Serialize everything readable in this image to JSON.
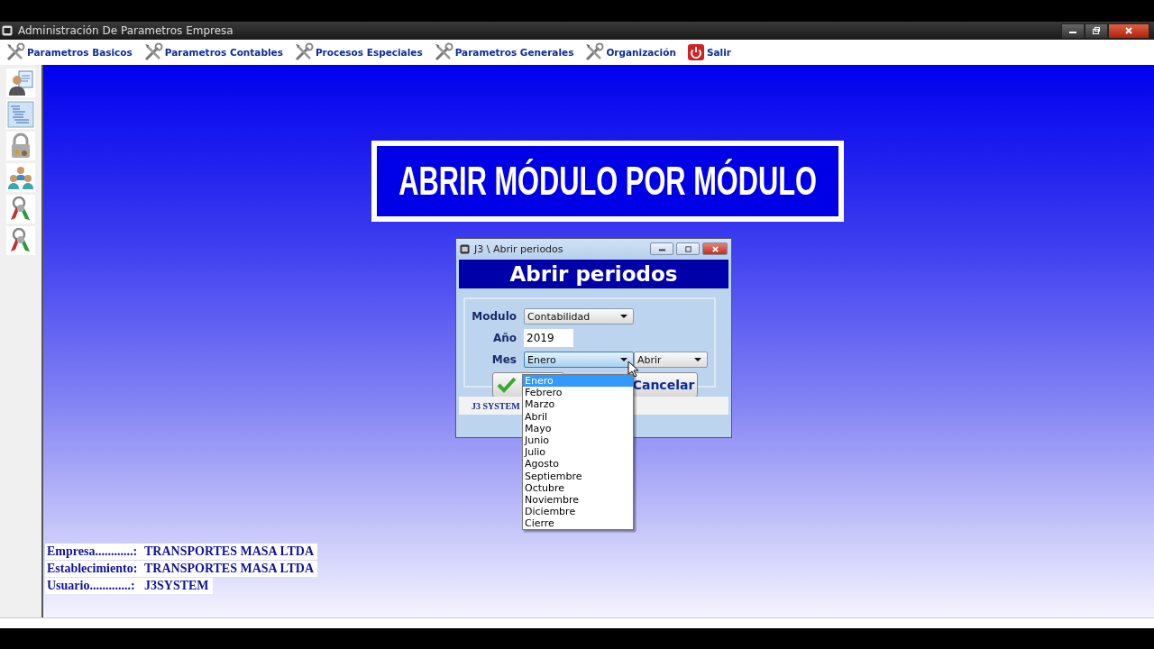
{
  "window": {
    "title": "Administración De Parametros Empresa"
  },
  "menu": [
    {
      "label": "Parametros Basicos",
      "kind": "tools"
    },
    {
      "label": "Parametros Contables",
      "kind": "tools"
    },
    {
      "label": "Procesos Especiales",
      "kind": "tools"
    },
    {
      "label": "Parametros Generales",
      "kind": "tools"
    },
    {
      "label": "Organización",
      "kind": "tools"
    },
    {
      "label": "Salir",
      "kind": "power"
    }
  ],
  "sidebar": [
    {
      "kind": "person-card"
    },
    {
      "kind": "document"
    },
    {
      "kind": "padlock"
    },
    {
      "kind": "people"
    },
    {
      "kind": "keys"
    },
    {
      "kind": "keys"
    }
  ],
  "banner": {
    "text": "ABRIR MÓDULO POR MÓDULO"
  },
  "dialog": {
    "title": "J3 \\ Abrir periodos",
    "heading": "Abrir periodos",
    "modulo": {
      "label": "Modulo",
      "value": "Contabilidad"
    },
    "ano": {
      "label": "Año",
      "value": "2019"
    },
    "mes": {
      "label": "Mes",
      "value": "Enero",
      "action": "Abrir"
    },
    "options": [
      {
        "label": "Enero",
        "selected": true
      },
      {
        "label": "Febrero",
        "selected": false
      },
      {
        "label": "Marzo",
        "selected": false
      },
      {
        "label": "Abril",
        "selected": false
      },
      {
        "label": "Mayo",
        "selected": false
      },
      {
        "label": "Junio",
        "selected": false
      },
      {
        "label": "Julio",
        "selected": false
      },
      {
        "label": "Agosto",
        "selected": false
      },
      {
        "label": "Septiembre",
        "selected": false
      },
      {
        "label": "Octubre",
        "selected": false
      },
      {
        "label": "Noviembre",
        "selected": false
      },
      {
        "label": "Diciembre",
        "selected": false
      },
      {
        "label": "Cierre",
        "selected": false
      }
    ],
    "cancel": "Cancelar",
    "status": "J3 SYSTEM"
  },
  "info": [
    {
      "label": "Empresa............:",
      "value": "TRANSPORTES MASA LTDA"
    },
    {
      "label": "Establecimiento:",
      "value": "TRANSPORTES MASA LTDA"
    },
    {
      "label": "Usuario.............:",
      "value": "J3SYSTEM"
    }
  ]
}
